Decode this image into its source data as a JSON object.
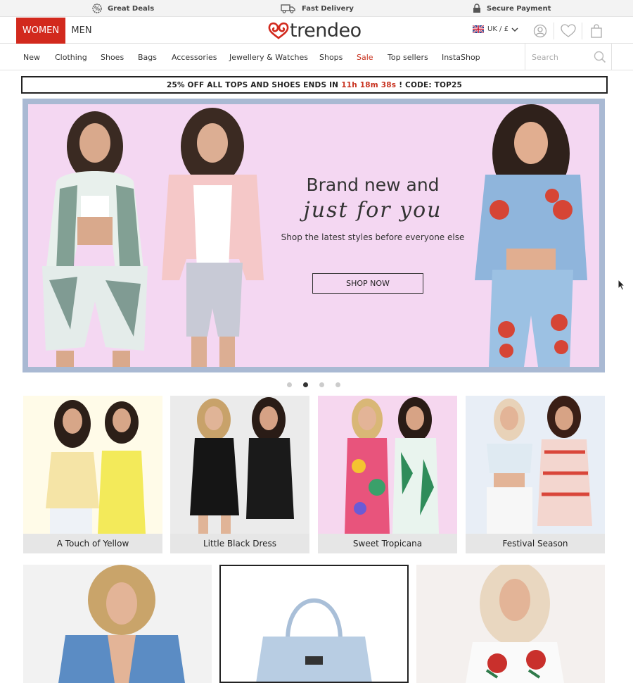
{
  "top_strip": {
    "perks": [
      {
        "label": "Great Deals",
        "icon": "badge-icon"
      },
      {
        "label": "Fast Delivery",
        "icon": "truck-icon"
      },
      {
        "label": "Secure Payment",
        "icon": "lock-icon"
      }
    ]
  },
  "header": {
    "gender_tabs": [
      "WOMEN",
      "MEN"
    ],
    "active_gender": "WOMEN",
    "logo_text": "trendeo",
    "locale": "UK / £",
    "icons": [
      "account-icon",
      "wishlist-icon",
      "bag-icon"
    ]
  },
  "nav": {
    "items": [
      "New",
      "Clothing",
      "Shoes",
      "Bags",
      "Accessories",
      "Jewellery & Watches",
      "Shops",
      "Sale",
      "Top sellers",
      "InstaShop"
    ],
    "search_placeholder": "Search"
  },
  "promo": {
    "prefix": "25% OFF ALL TOPS AND SHOES ENDS IN",
    "timer": "11h 18m 38s",
    "suffix": "! CODE: TOP25"
  },
  "hero": {
    "headline": "Brand new and",
    "script_line": "just for you",
    "subline": "Shop the latest styles before everyone else",
    "cta": "SHOP NOW",
    "slide_count": 4,
    "active_slide": 2
  },
  "categories": [
    {
      "label": "A Touch of Yellow"
    },
    {
      "label": "Little Black Dress"
    },
    {
      "label": "Sweet Tropicana"
    },
    {
      "label": "Festival Season"
    }
  ],
  "colors": {
    "accent": "#d2291d",
    "sale": "#c8321f",
    "hero_bg": "#f4d7f2",
    "hero_frame": "#a9b9d3"
  }
}
